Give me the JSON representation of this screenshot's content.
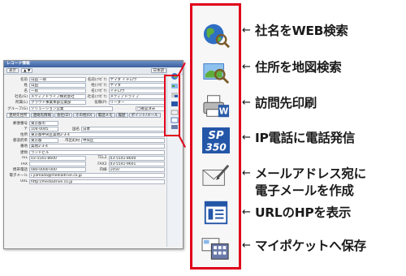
{
  "window": {
    "title": "レコード情報",
    "toolbar": {
      "left": "表示",
      "mid": "▲ ▼",
      "right": "日本語"
    },
    "fields": [
      {
        "label": "名前",
        "value": "山田 一郎",
        "label2": "名前(ﾌﾘｶﾞﾅ)",
        "value2": "ヤマダ イチロウ"
      },
      {
        "label": "姓",
        "value": "山田",
        "label2": "姓(ﾌﾘｶﾞﾅ)",
        "value2": "ヤマダ"
      },
      {
        "label": "名",
        "value": "一郎",
        "label2": "名(ﾌﾘｶﾞﾅ)",
        "value2": "イチロウ"
      },
      {
        "label": "社名(G)",
        "value": "メディアドライブ株式会社",
        "label2": "社名(ﾌﾘｶﾞﾅ)",
        "value2": "メディアドライブ"
      },
      {
        "label": "所属(L)",
        "value": "クラウド事業本部営業部",
        "label2": "役職(P)",
        "value2": "リーダー"
      },
      {
        "label": "グループ(G)",
        "value": "ソリューション営業",
        "label2": "",
        "value2": "□確認済み"
      }
    ],
    "tabs": [
      "連絡先住所",
      "連絡先情報",
      "会社(D)",
      "その他(O)",
      "電話メモ",
      "履歴",
      "ポイント/メール"
    ],
    "address": [
      {
        "label": "郵便番号",
        "value": "東京都市",
        "label2": "",
        "value2": ""
      },
      {
        "label": "〒",
        "value": "104-0045",
        "label2": "国名",
        "value2": "日本"
      },
      {
        "label": "住所",
        "value": "東京都中央区築地2-3-4",
        "label2": "",
        "value2": ""
      },
      {
        "label": "都道府県",
        "value": "東京都",
        "label2": "市区町村",
        "value2": "中央区"
      },
      {
        "label": "番地",
        "value": "築地2-3-4",
        "label2": "",
        "value2": ""
      },
      {
        "label": "建物",
        "value": "ランドビル",
        "label2": "",
        "value2": ""
      },
      {
        "label": "TEL",
        "value": "03-5541-8600",
        "label2": "TEL2",
        "value2": "03-5541-8600"
      },
      {
        "label": "FAX",
        "value": "",
        "label2": "FAX2",
        "value2": "03-5541-9601"
      },
      {
        "label": "携帯電話",
        "value": "080-0000-000",
        "label2": "内線",
        "value2": "1050"
      },
      {
        "label": "電子メール",
        "value": "i.yamada@mediadrive.co.jp",
        "label2": "",
        "value2": ""
      },
      {
        "label": "URL",
        "value": "http://mediadrive.co.jp",
        "label2": "",
        "value2": ""
      }
    ]
  },
  "features": [
    {
      "icon": "globe-search-icon",
      "text": "社名をWEB検索"
    },
    {
      "icon": "map-search-icon",
      "text": "住所を地図検索"
    },
    {
      "icon": "print-word-icon",
      "text": "訪問先印刷"
    },
    {
      "icon": "skype-350-icon",
      "text": "IP電話に電話発信"
    },
    {
      "icon": "mail-pencil-icon",
      "text": "メールアドレス宛に"
    },
    {
      "icon": "web-page-icon",
      "text": "URLのHPを表示"
    },
    {
      "icon": "my-pocket-icon",
      "text": "マイポケットへ保存"
    }
  ],
  "feature_mail_second_line": "電子メールを作成",
  "arrow_glyph": "←",
  "icon_text": {
    "skype_top": "SP",
    "skype_bottom": "350"
  },
  "colors": {
    "highlight": "#e0001a",
    "text": "#1a1a1a"
  }
}
